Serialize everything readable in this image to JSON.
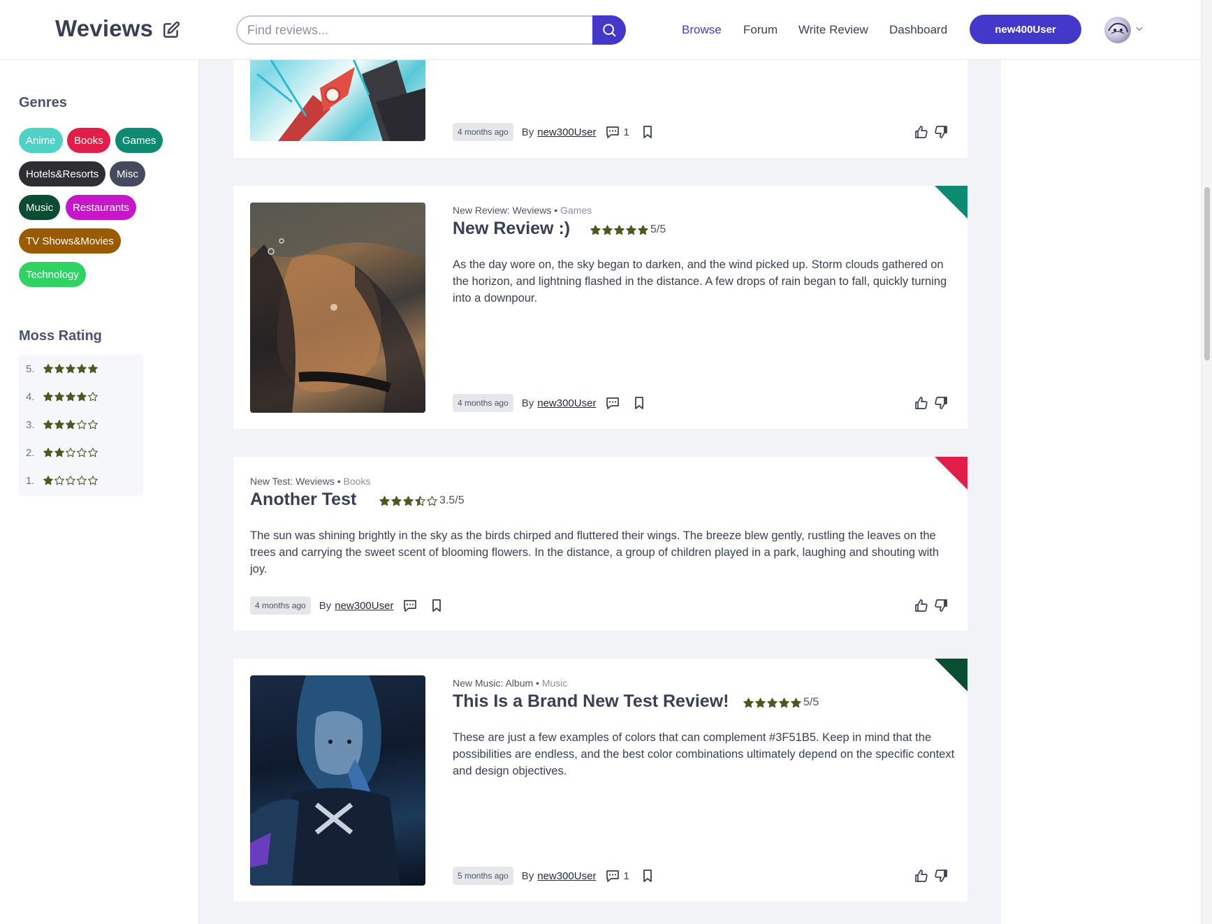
{
  "header": {
    "logo": "Weviews",
    "search_placeholder": "Find reviews...",
    "nav": [
      "Browse",
      "Forum",
      "Write Review",
      "Dashboard"
    ],
    "user_button": "new400User"
  },
  "sidebar": {
    "genres_title": "Genres",
    "genres": [
      {
        "label": "Anime",
        "color": "#4fd1c5"
      },
      {
        "label": "Books",
        "color": "#e11d48"
      },
      {
        "label": "Games",
        "color": "#0f8a72"
      },
      {
        "label": "Hotels&Resorts",
        "color": "#2f2f33"
      },
      {
        "label": "Misc",
        "color": "#454a5e"
      },
      {
        "label": "Music",
        "color": "#0b4d33"
      },
      {
        "label": "Restaurants",
        "color": "#c516c9"
      },
      {
        "label": "TV Shows&Movies",
        "color": "#9a5a00"
      },
      {
        "label": "Technology",
        "color": "#2fd263"
      }
    ],
    "rating_title": "Moss Rating",
    "ratings": [
      "5.",
      "4.",
      "3.",
      "2.",
      "1."
    ]
  },
  "reviews": [
    {
      "time": "4 months ago",
      "by": "By",
      "author": "new300User",
      "comments": "1"
    },
    {
      "meta_source": "New Review: Weviews",
      "genre": "Games",
      "title": "New Review :)",
      "rating_text": "5/5",
      "rating_value": 5,
      "body": "As the day wore on, the sky began to darken, and the wind picked up. Storm clouds gathered on the horizon, and lightning flashed in the distance. A few drops of rain began to fall, quickly turning into a downpour.",
      "time": "4 months ago",
      "by": "By",
      "author": "new300User",
      "corner_color": "#0f8a72"
    },
    {
      "meta_source": "New Test: Weviews",
      "genre": "Books",
      "title": "Another Test",
      "rating_text": "3.5/5",
      "rating_value": 3.5,
      "body": "The sun was shining brightly in the sky as the birds chirped and fluttered their wings. The breeze blew gently, rustling the leaves on the trees and carrying the sweet scent of blooming flowers. In the distance, a group of children played in a park, laughing and shouting with joy.",
      "time": "4 months ago",
      "by": "By",
      "author": "new300User",
      "corner_color": "#e11d48"
    },
    {
      "meta_source": "New Music: Album",
      "genre": "Music",
      "title": "This Is a Brand New Test Review!",
      "rating_text": "5/5",
      "rating_value": 5,
      "body": "These are just a few examples of colors that can complement #3F51B5. Keep in mind that the possibilities are endless, and the best color combinations ultimately depend on the specific context and design objectives.",
      "time": "5 months ago",
      "by": "By",
      "author": "new300User",
      "comments": "1",
      "corner_color": "#0b4d33"
    }
  ],
  "colors": {
    "brand": "#4338ca",
    "star": "#4a5a1f"
  }
}
